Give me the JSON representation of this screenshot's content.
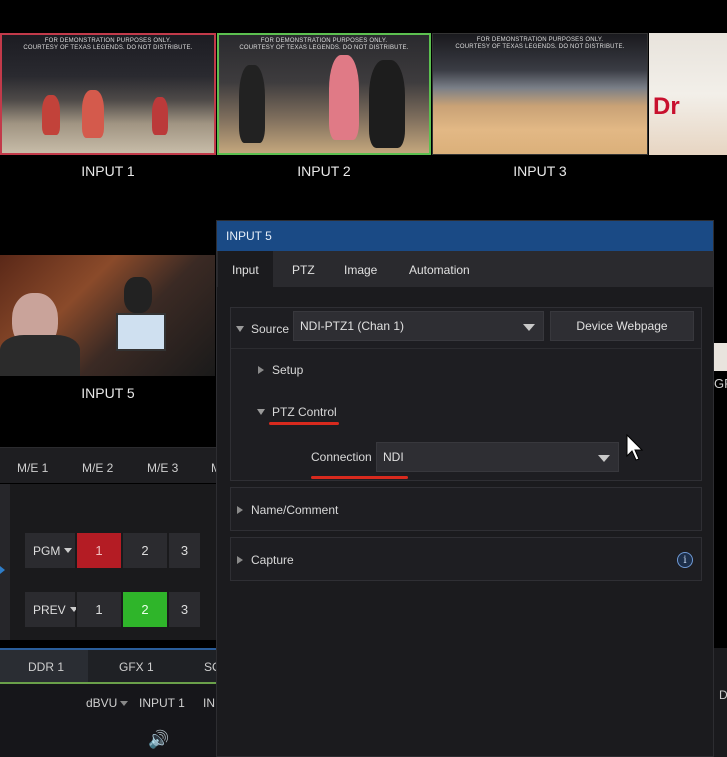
{
  "monitors": {
    "watermark": "FOR DEMONSTRATION PURPOSES ONLY.\nCOURTESY OF TEXAS LEGENDS. DO NOT DISTRIBUTE.",
    "inputs": [
      {
        "label": "INPUT 1"
      },
      {
        "label": "INPUT 2"
      },
      {
        "label": "INPUT 3"
      }
    ],
    "cam_label": "INPUT 5",
    "right_edge_text": "GF"
  },
  "switcher": {
    "me_tabs": [
      "M/E 1",
      "M/E 2",
      "M/E 3",
      "M"
    ],
    "pgm_label": "PGM",
    "prev_label": "PREV",
    "buttons": [
      "1",
      "2",
      "3"
    ],
    "pgm_active": "1",
    "prev_active": "2"
  },
  "media": {
    "tabs": [
      "DDR 1",
      "GFX 1",
      "SO"
    ],
    "audio_labels": [
      "dBVU",
      "INPUT 1",
      "IN"
    ],
    "speaker_icon": "🔊",
    "right_edge_text": "D"
  },
  "panel": {
    "title": "INPUT 5",
    "tabs": [
      "Input",
      "PTZ",
      "Image",
      "Automation"
    ],
    "active_tab": "Input",
    "source": {
      "label": "Source",
      "value": "NDI-PTZ1 (Chan 1)",
      "device_button": "Device Webpage"
    },
    "setup_label": "Setup",
    "ptz_control_label": "PTZ Control",
    "connection": {
      "label": "Connection",
      "value": "NDI"
    },
    "name_comment_label": "Name/Comment",
    "capture_label": "Capture",
    "info_icon": "i",
    "highlight_color": "#d82a1e",
    "title_color": "#1a4a85"
  }
}
